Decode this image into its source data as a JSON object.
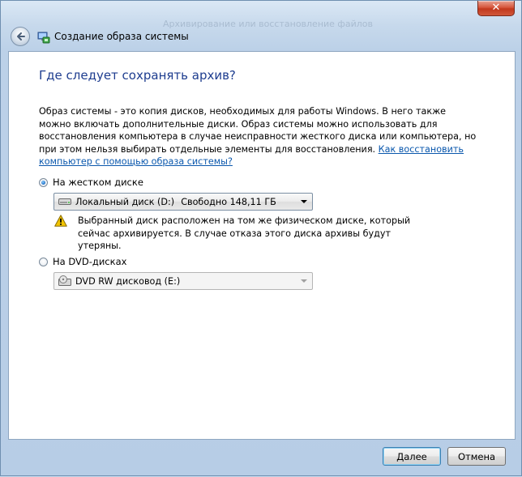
{
  "window": {
    "title": "Создание образа системы",
    "ghost_title": "Архивирование или восстановление файлов",
    "close_glyph": "✕"
  },
  "page": {
    "heading": "Где следует сохранять архив?",
    "description": "Образ системы - это копия дисков, необходимых для работы Windows. В него также можно включать дополнительные диски. Образ системы можно использовать для восстановления компьютера в случае неисправности жесткого диска или компьютера, но при этом нельзя выбирать отдельные элементы для восстановления.",
    "help_link": "Как восстановить компьютер с помощью образа системы?"
  },
  "options": {
    "hard_disk": {
      "label": "На жестком диске",
      "selected": true,
      "drive_name": "Локальный диск (D:)",
      "drive_free": "Свободно 148,11 ГБ",
      "warning": "Выбранный диск расположен на том же физическом диске, который сейчас архивируется. В случае отказа этого диска архивы будут утеряны."
    },
    "dvd": {
      "label": "На DVD-дисках",
      "selected": false,
      "drive_name": "DVD RW дисковод (E:)"
    }
  },
  "buttons": {
    "next": "Далее",
    "cancel": "Отмена"
  },
  "colors": {
    "heading": "#1e3d8f",
    "link": "#0b58ad",
    "warning": "#f2c400"
  }
}
